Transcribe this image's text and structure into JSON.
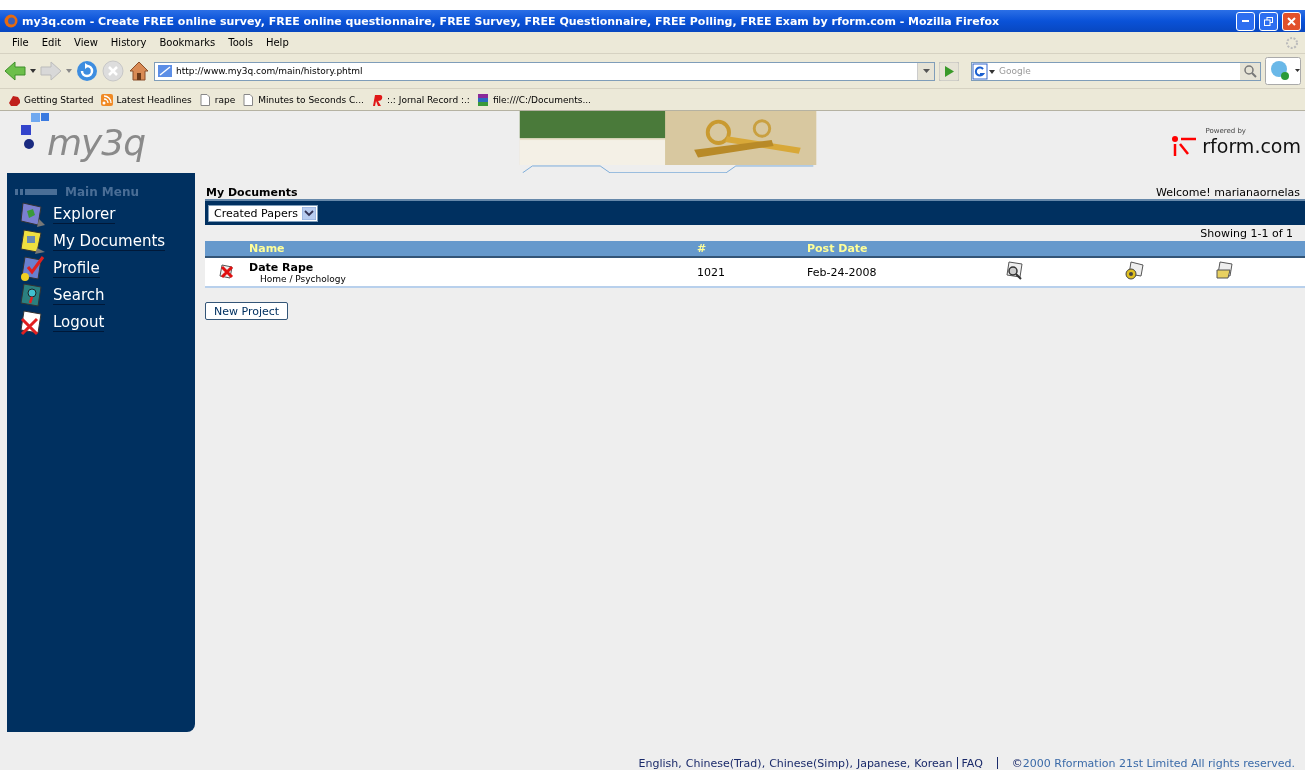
{
  "window": {
    "title": "my3q.com - Create FREE online survey, FREE online questionnaire, FREE Survey, FREE Questionnaire, FREE Polling, FREE Exam by rform.com - Mozilla Firefox"
  },
  "menu": [
    "File",
    "Edit",
    "View",
    "History",
    "Bookmarks",
    "Tools",
    "Help"
  ],
  "toolbar": {
    "address": "http://www.my3q.com/main/history.phtml",
    "search_placeholder": "Google"
  },
  "bookmarks": [
    "Getting Started",
    "Latest Headlines",
    "rape",
    "Minutes to Seconds C...",
    ":.: Jornal Record :.:",
    "file:///C:/Documents..."
  ],
  "site": {
    "logo": "my3q",
    "powered_by": "Powered by",
    "brand": "rform.com"
  },
  "sidebar": {
    "heading": "Main Menu",
    "items": [
      "Explorer",
      "My Documents",
      "Profile",
      "Search",
      "Logout"
    ]
  },
  "page_title": "My Documents",
  "welcome": "Welcome! marianaornelas",
  "filter": {
    "value": "Created Papers"
  },
  "showing": "Showing 1-1 of 1",
  "table": {
    "columns": [
      "Name",
      "#",
      "Post Date"
    ],
    "rows": [
      {
        "name": "Date Rape",
        "path": "Home / Psychology",
        "number": "1021",
        "date": "Feb-24-2008"
      }
    ]
  },
  "new_button": "New Project",
  "footer": {
    "languages": [
      "English,",
      "Chinese(Trad),",
      "Chinese(Simp),",
      "Japanese,",
      "Korean"
    ],
    "faq": "FAQ",
    "copyright_sign": "©",
    "copyright": "2000 Rformation 21st Limited All rights reserved."
  }
}
